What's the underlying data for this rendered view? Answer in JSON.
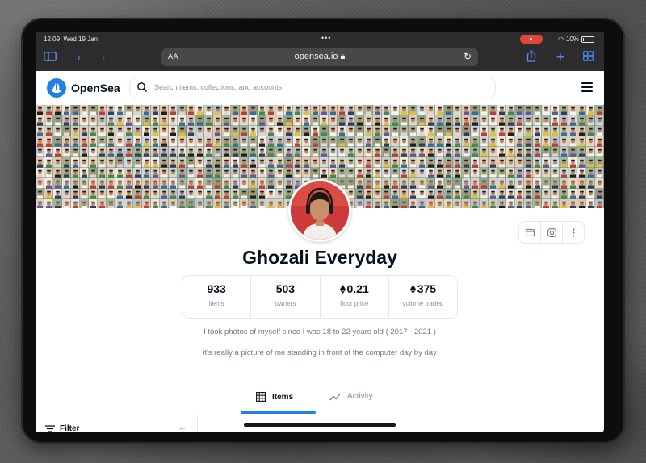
{
  "status_bar": {
    "time": "12.09",
    "date": "Wed 19 Jan",
    "battery": "10%"
  },
  "browser": {
    "aa_label": "AA",
    "url": "opensea.io"
  },
  "header": {
    "brand": "OpenSea",
    "search_placeholder": "Search items, collections, and accounts"
  },
  "collection": {
    "name": "Ghozali Everyday",
    "stats": [
      {
        "value": "933",
        "label": "items",
        "eth": false
      },
      {
        "value": "503",
        "label": "owners",
        "eth": false
      },
      {
        "value": "0.21",
        "label": "floor price",
        "eth": true
      },
      {
        "value": "375",
        "label": "volume traded",
        "eth": true
      }
    ],
    "description": [
      "I took photos of myself since I was 18 to 22 years old ( 2017 - 2021 )",
      "it's really a picture of me standing in front of the computer day by day"
    ]
  },
  "tabs": [
    {
      "label": "Items",
      "icon": "grid-icon",
      "active": true
    },
    {
      "label": "Activity",
      "icon": "activity-chart-icon",
      "active": false
    }
  ],
  "sidebar": {
    "filter_label": "Filter"
  },
  "colors": {
    "accent": "#2081e2",
    "text_primary": "#04111d",
    "text_secondary": "#707a83",
    "safari_blue": "#4f8ff7"
  }
}
